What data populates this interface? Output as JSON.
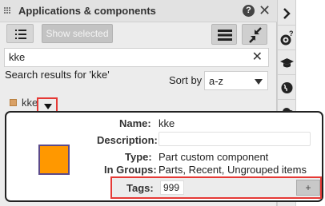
{
  "panel": {
    "title": "Applications & components",
    "help_icon": "?",
    "close_icon": "✕"
  },
  "toolbar": {
    "show_selected_label": "Show selected"
  },
  "search": {
    "value": "kke",
    "results_text": "Search results for 'kke'"
  },
  "sort": {
    "label": "Sort by",
    "value": "a-z"
  },
  "list": {
    "item_label": "kke",
    "item_color": "#d9a065"
  },
  "details": {
    "name_label": "Name:",
    "name_value": "kke",
    "description_label": "Description:",
    "type_label": "Type:",
    "type_value": "Part custom component",
    "groups_label": "In Groups:",
    "groups_value": "Parts, Recent, Ungrouped items",
    "tags_label": "Tags:",
    "tags_value": "999",
    "add_tag_label": "+",
    "swatch_color": "#ff9800"
  },
  "rail": {
    "items": [
      {
        "icon": "chevron-right-icon",
        "glyph": ">"
      },
      {
        "icon": "settings-help-icon",
        "glyph": "⚙"
      },
      {
        "icon": "graduation-cap-icon",
        "glyph": "🎓"
      },
      {
        "icon": "globe-icon",
        "glyph": "🌐"
      },
      {
        "icon": "cloud-icon",
        "glyph": "☁"
      }
    ]
  },
  "colors": {
    "highlight": "#e53935",
    "accent_orange": "#ff9800"
  }
}
